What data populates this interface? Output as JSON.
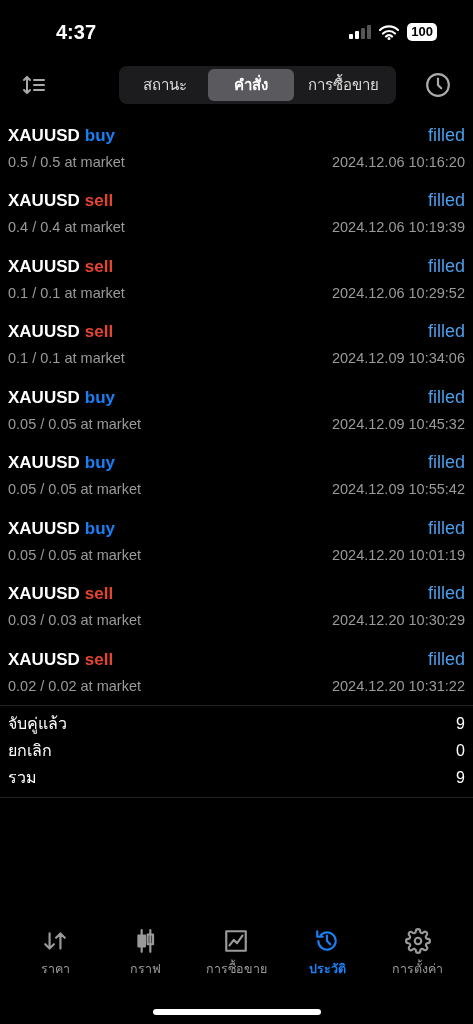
{
  "status_bar": {
    "time": "4:37",
    "battery": "100"
  },
  "segments": [
    {
      "label": "สถานะ",
      "selected": false
    },
    {
      "label": "คำสั่ง",
      "selected": true
    },
    {
      "label": "การซื้อขาย",
      "selected": false
    }
  ],
  "orders": [
    {
      "symbol": "XAUUSD",
      "side": "buy",
      "kind": "buy",
      "volume": "0.5 / 0.5 at market",
      "status": "filled",
      "time": "2024.12.06 10:16:20"
    },
    {
      "symbol": "XAUUSD",
      "side": "sell",
      "kind": "sell",
      "volume": "0.4 / 0.4 at market",
      "status": "filled",
      "time": "2024.12.06 10:19:39"
    },
    {
      "symbol": "XAUUSD",
      "side": "sell",
      "kind": "sell",
      "volume": "0.1 / 0.1 at market",
      "status": "filled",
      "time": "2024.12.06 10:29:52"
    },
    {
      "symbol": "XAUUSD",
      "side": "sell",
      "kind": "sell",
      "volume": "0.1 / 0.1 at market",
      "status": "filled",
      "time": "2024.12.09 10:34:06"
    },
    {
      "symbol": "XAUUSD",
      "side": "buy",
      "kind": "buy",
      "volume": "0.05 / 0.05 at market",
      "status": "filled",
      "time": "2024.12.09 10:45:32"
    },
    {
      "symbol": "XAUUSD",
      "side": "buy",
      "kind": "buy",
      "volume": "0.05 / 0.05 at market",
      "status": "filled",
      "time": "2024.12.09 10:55:42"
    },
    {
      "symbol": "XAUUSD",
      "side": "buy",
      "kind": "buy",
      "volume": "0.05 / 0.05 at market",
      "status": "filled",
      "time": "2024.12.20 10:01:19"
    },
    {
      "symbol": "XAUUSD",
      "side": "sell",
      "kind": "sell",
      "volume": "0.03 / 0.03 at market",
      "status": "filled",
      "time": "2024.12.20 10:30:29"
    },
    {
      "symbol": "XAUUSD",
      "side": "sell",
      "kind": "sell",
      "volume": "0.02 / 0.02 at market",
      "status": "filled",
      "time": "2024.12.20 10:31:22"
    }
  ],
  "summary": [
    {
      "label": "จับคู่แล้ว",
      "value": "9"
    },
    {
      "label": "ยกเลิก",
      "value": "0"
    },
    {
      "label": "รวม",
      "value": "9"
    }
  ],
  "tab_bar": [
    {
      "label": "ราคา",
      "kind": "quotes",
      "selected": false
    },
    {
      "label": "กราฟ",
      "kind": "chart",
      "selected": false
    },
    {
      "label": "การซื้อขาย",
      "kind": "trade",
      "selected": false
    },
    {
      "label": "ประวัติ",
      "kind": "history",
      "selected": true
    },
    {
      "label": "การตั้งค่า",
      "kind": "settings",
      "selected": false
    }
  ]
}
